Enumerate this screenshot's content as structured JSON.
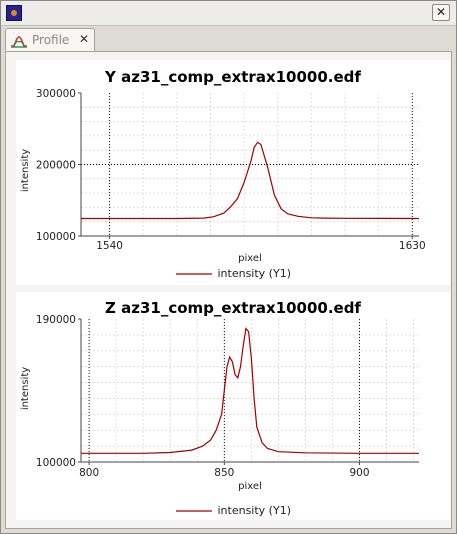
{
  "window": {
    "title": "",
    "close_label": "✕"
  },
  "tabs": [
    {
      "label": "Profile",
      "close_label": "✕"
    }
  ],
  "chart_data": [
    {
      "type": "line",
      "title": "Y az31_comp_extrax10000.edf",
      "xlabel": "pixel",
      "ylabel": "intensity",
      "xlim": [
        1531.5,
        1632
      ],
      "ylim": [
        100000,
        300000
      ],
      "xticks": [
        "1540",
        "1630"
      ],
      "xtick_values": [
        1540,
        1630
      ],
      "yticks": [
        "100000",
        "200000",
        "300000"
      ],
      "ytick_values": [
        100000,
        200000,
        300000
      ],
      "grid": true,
      "legend_position": "bottom",
      "series": [
        {
          "name": "intensity (Y1)",
          "color": "#a00000",
          "x": [
            1531.5,
            1560,
            1568,
            1571,
            1574,
            1576,
            1578,
            1580,
            1582,
            1583,
            1584,
            1585,
            1587,
            1589,
            1591,
            1593,
            1596,
            1600,
            1604,
            1610,
            1620,
            1632
          ],
          "y": [
            124500,
            124500,
            125000,
            127000,
            132000,
            141000,
            152000,
            175000,
            204000,
            224000,
            231000,
            228000,
            196000,
            157000,
            138000,
            131000,
            127500,
            125500,
            125000,
            124800,
            124600,
            124500
          ]
        }
      ]
    },
    {
      "type": "line",
      "title": "Z az31_comp_extrax10000.edf",
      "xlabel": "pixel",
      "ylabel": "intensity",
      "xlim": [
        797,
        922
      ],
      "ylim": [
        100000,
        190000
      ],
      "xticks": [
        "800",
        "850",
        "900"
      ],
      "xtick_values": [
        800,
        850,
        900
      ],
      "yticks": [
        "100000",
        "190000"
      ],
      "ytick_values": [
        100000,
        190000
      ],
      "grid": true,
      "legend_position": "bottom",
      "series": [
        {
          "name": "intensity (Y1)",
          "color": "#a00000",
          "x": [
            797,
            820,
            830,
            838,
            842,
            845,
            847,
            849,
            850,
            851,
            852,
            853,
            854,
            855,
            856,
            857,
            858,
            859,
            860,
            861,
            862,
            864,
            866,
            870,
            880,
            900,
            922
          ],
          "y": [
            105500,
            105500,
            106000,
            107500,
            110000,
            114000,
            120000,
            130000,
            145000,
            160000,
            166000,
            163000,
            155000,
            153000,
            160000,
            173000,
            184000,
            182000,
            165000,
            140000,
            122000,
            112000,
            108500,
            106500,
            105800,
            105500,
            105500
          ]
        }
      ]
    }
  ]
}
